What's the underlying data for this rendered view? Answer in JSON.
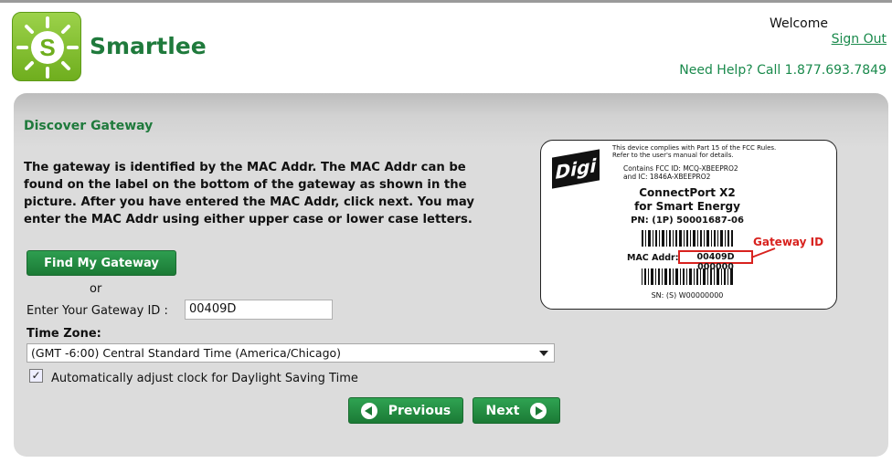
{
  "header": {
    "brand": "Smartlee",
    "welcome": "Welcome",
    "sign_out": "Sign Out",
    "help": "Need Help? Call  1.877.693.7849"
  },
  "panel": {
    "title": "Discover Gateway",
    "description": "The gateway is identified by the MAC Addr. The MAC Addr can be found on the label on the bottom of the gateway as shown in the picture. After you have entered the MAC Addr, click next. You may enter the MAC Addr using either upper case or lower case letters.",
    "find_button": "Find My Gateway",
    "or": "or",
    "gateway_label": "Enter Your Gateway ID :",
    "gateway_value": "00409D",
    "timezone_label": "Time Zone:",
    "timezone_value": "(GMT -6:00) Central Standard Time (America/Chicago)",
    "dst_label": "Automatically adjust clock for Daylight Saving Time",
    "dst_checked": true,
    "previous": "Previous",
    "next": "Next"
  },
  "device_label": {
    "brand": "Digi",
    "fcc_notice": "This device complies with Part 15 of the FCC Rules. Refer to the user's manual for details.",
    "contains_line1": "Contains   FCC ID: MCQ-XBEEPRO2",
    "contains_line2": "and    IC:  1846A-XBEEPRO2",
    "product_line1": "ConnectPort X2",
    "product_line2": "for Smart Energy",
    "part_number": "PN: (1P) 50001687-06",
    "mac_label": "MAC Addr:",
    "mac_value": "00409D 000000",
    "callout": "Gateway ID",
    "serial": "SN: (S) W00000000"
  },
  "colors": {
    "brand_green": "#1f7a3c",
    "button_green": "#1b7a35",
    "highlight_red": "#d8221e",
    "panel_gray": "#dcdcdc"
  }
}
